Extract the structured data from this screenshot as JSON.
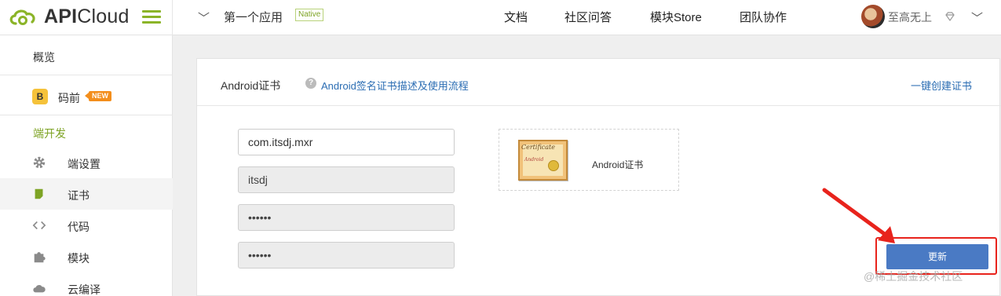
{
  "header": {
    "brand": {
      "api": "API",
      "cloud": "Cloud"
    },
    "app_switch": "﹀",
    "app_name": "第一个应用",
    "app_badge": "Native",
    "nav": [
      "文档",
      "社区问答",
      "模块Store",
      "团队协作"
    ],
    "username": "至高无上",
    "user_menu_chevron": "﹀"
  },
  "sidebar": {
    "overview": "概览",
    "maqian": {
      "icon_text": "B",
      "label": "码前",
      "badge": "NEW"
    },
    "section": "端开发",
    "items": [
      {
        "icon": "gear-icon",
        "label": "端设置"
      },
      {
        "icon": "certificate-icon",
        "label": "证书"
      },
      {
        "icon": "code-icon",
        "label": "代码"
      },
      {
        "icon": "puzzle-icon",
        "label": "模块"
      },
      {
        "icon": "cloud-icon",
        "label": "云编译"
      }
    ]
  },
  "card": {
    "title": "Android证书",
    "help_link": "Android签名证书描述及使用流程",
    "create_link": "一键创建证书",
    "fields": {
      "package": "com.itsdj.mxr",
      "alias": "itsdj",
      "password1": "••••••",
      "password2": "••••••"
    },
    "cert_image": {
      "heading": "Certificate",
      "signature": "Android"
    },
    "cert_label": "Android证书",
    "update_button": "更新"
  },
  "watermark": "@稀土掘金技术社区",
  "colors": {
    "brand_green": "#8bb428",
    "link_blue": "#2b6db3",
    "button_blue": "#4a7ac4",
    "badge_orange": "#f38e1c",
    "annotation_red": "#e8231c"
  }
}
